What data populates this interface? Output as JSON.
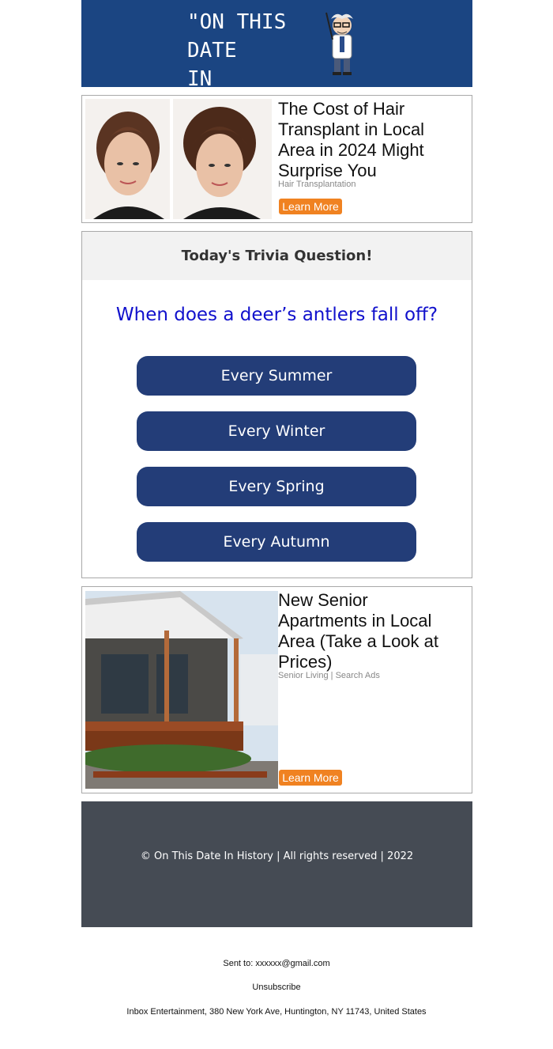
{
  "header": {
    "brand_line1": "\"ON THIS DATE",
    "brand_line2": "IN HISTORY...\""
  },
  "ad1": {
    "title": "The Cost of Hair Transplant in Local Area in 2024 Might Surprise You",
    "source": "Hair Transplantation",
    "button": "Learn More"
  },
  "trivia": {
    "heading": "Today's Trivia Question!",
    "question": "When does a deer’s antlers fall off?",
    "answers": [
      "Every Summer",
      "Every Winter",
      "Every Spring",
      "Every Autumn"
    ]
  },
  "ad2": {
    "title": "New Senior Apartments in Local Area (Take a Look at Prices)",
    "source": "Senior Living | Search Ads",
    "button": "Learn More"
  },
  "footer": {
    "copyright": "© On This Date In History | All rights reserved | 2022"
  },
  "meta": {
    "sent_to_label": "Sent to:",
    "sent_to_email": "xxxxxx@gmail.com",
    "unsubscribe": "Unsubscribe",
    "address": "Inbox Entertainment, 380 New York Ave, Huntington, NY 11743, United States"
  },
  "colors": {
    "header_bg": "#1b4582",
    "answer_bg": "#233d78",
    "question_text": "#1010cc",
    "cta_orange": "#f08221",
    "footer_bg": "#454b54"
  }
}
